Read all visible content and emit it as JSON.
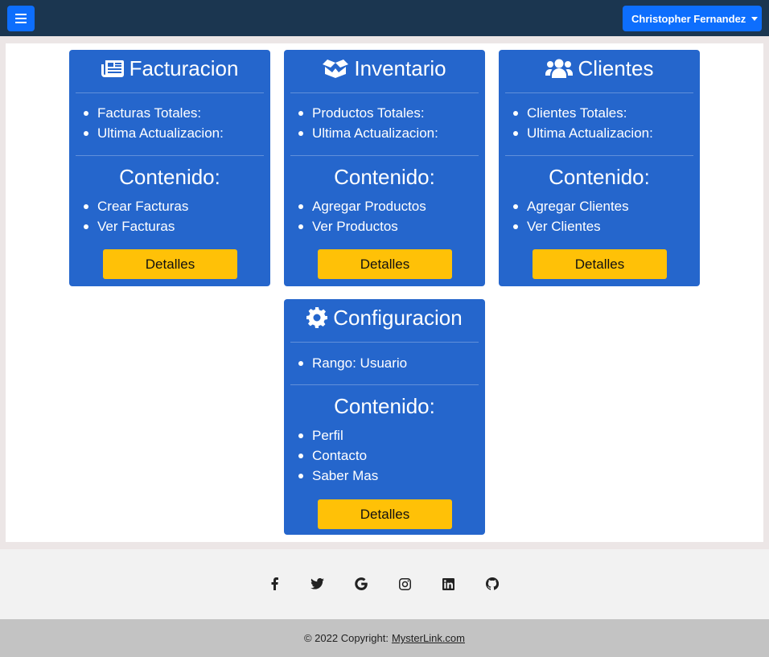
{
  "navbar": {
    "menu_icon": "hamburger-icon",
    "user_name": "Christopher Fernandez",
    "user_caret_icon": "caret-down-icon"
  },
  "cards": [
    {
      "icon": "newspaper-icon",
      "title": "Facturacion",
      "stats": [
        "Facturas Totales:",
        "Ultima Actualizacion:"
      ],
      "content_title": "Contenido:",
      "content_items": [
        "Crear Facturas",
        "Ver Facturas"
      ],
      "button_label": "Detalles"
    },
    {
      "icon": "box-open-icon",
      "title": "Inventario",
      "stats": [
        "Productos Totales:",
        "Ultima Actualizacion:"
      ],
      "content_title": "Contenido:",
      "content_items": [
        "Agregar Productos",
        "Ver Productos"
      ],
      "button_label": "Detalles"
    },
    {
      "icon": "users-icon",
      "title": "Clientes",
      "stats": [
        "Clientes Totales:",
        "Ultima Actualizacion:"
      ],
      "content_title": "Contenido:",
      "content_items": [
        "Agregar Clientes",
        "Ver Clientes"
      ],
      "button_label": "Detalles"
    },
    {
      "icon": "gear-icon",
      "title": "Configuracion",
      "stats": [
        "Rango: Usuario"
      ],
      "content_title": "Contenido:",
      "content_items": [
        "Perfil",
        "Contacto",
        "Saber Mas"
      ],
      "button_label": "Detalles"
    }
  ],
  "footer": {
    "social_icons": [
      "facebook-icon",
      "twitter-icon",
      "google-icon",
      "instagram-icon",
      "linkedin-icon",
      "github-icon"
    ],
    "copyright_text": "© 2022 Copyright:",
    "copyright_link": "MysterLink.com"
  },
  "colors": {
    "navbar": "#1b3650",
    "primary_button": "#0d6efd",
    "card": "#2566cc",
    "detail_button": "#ffc107",
    "page_background": "#ece6e6",
    "footer": "#f2f2f2",
    "copyright_bar": "#c3c3c3"
  }
}
